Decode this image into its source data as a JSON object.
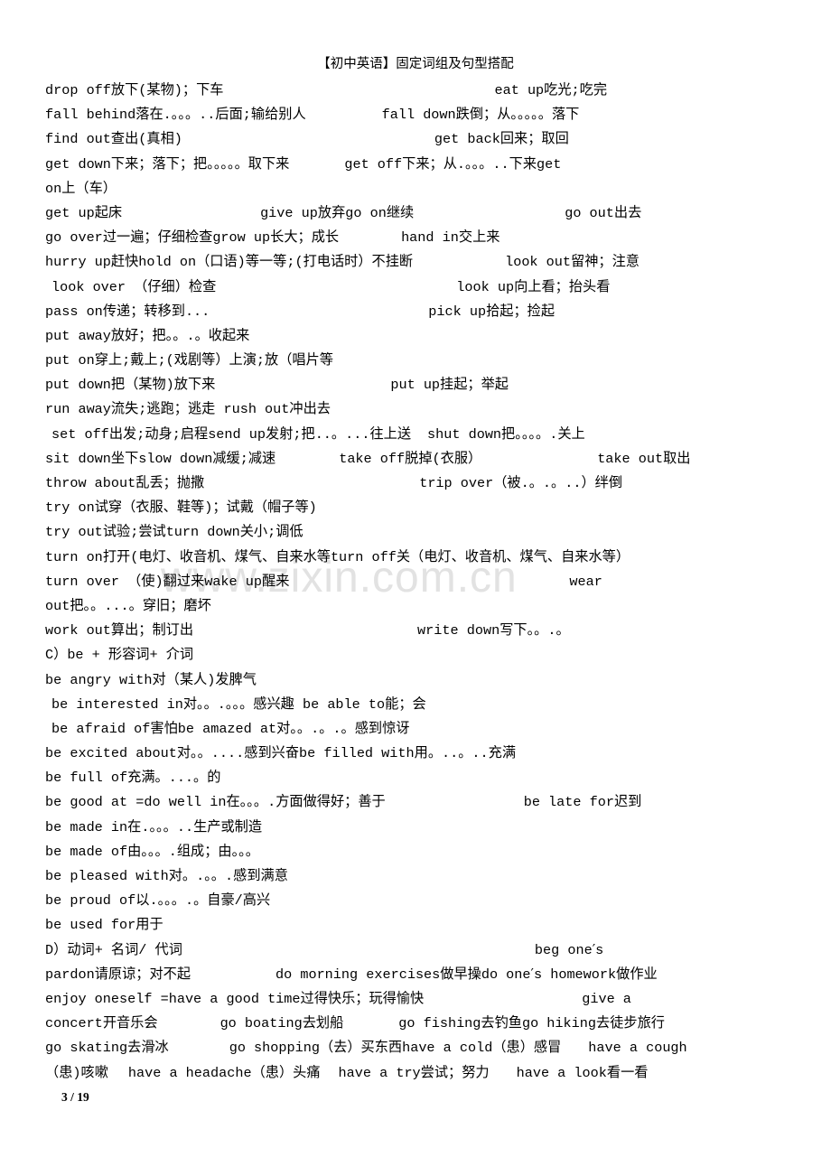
{
  "document": {
    "title": "【初中英语】固定词组及句型搭配",
    "page_number": "3 / 19",
    "watermark": "www.zixin.com.cn"
  },
  "lines": [
    {
      "id": "l1",
      "indent": 0,
      "left": "drop off放下(某物)；下车",
      "gap": 300,
      "right": "eat up吃光;吃完"
    },
    {
      "id": "l2",
      "indent": 0,
      "left": "fall behind落在.。。。..后面;输给别人",
      "gap": 84,
      "right": "fall down跌倒；从。。。。。落下"
    },
    {
      "id": "l3",
      "indent": 0,
      "left": "find out查出(真相)",
      "gap": 279,
      "right": "get back回来；取回"
    },
    {
      "id": "l4",
      "indent": 0,
      "left": "get down下来；落下；把。。。。。取下来",
      "gap": 61,
      "right": "get off下来；从.。。。..下来get"
    },
    {
      "id": "l5",
      "indent": 0,
      "left": "on上（车）",
      "gap": 0,
      "right": ""
    },
    {
      "id": "l6",
      "indent": 0,
      "left": "get up起床",
      "gap": 153,
      "right": "give up放弃go on继续",
      "gap2": 167,
      "right2": "go out出去"
    },
    {
      "id": "l7",
      "indent": 0,
      "left": "go over过一遍；仔细检查grow up长大；成长",
      "gap": 69,
      "right": "hand in交上来"
    },
    {
      "id": "l8",
      "indent": 0,
      "left": "hurry up赶快hold on（口语)等一等;(打电话时）不挂断",
      "gap": 102,
      "right": "look out留神；注意"
    },
    {
      "id": "l9",
      "indent": 7,
      "left": "look over （仔细）检查",
      "gap": 266,
      "right": "look up向上看；抬头看"
    },
    {
      "id": "l10",
      "indent": 0,
      "left": "pass on传递；转移到...",
      "gap": 242,
      "right": "pick up拾起；捡起"
    },
    {
      "id": "l11",
      "indent": 0,
      "left": "put away放好；把。。.。收起来",
      "gap": 0,
      "right": ""
    },
    {
      "id": "l12",
      "indent": 0,
      "left": "put on穿上;戴上;(戏剧等）上演;放（唱片等",
      "gap": 0,
      "right": ""
    },
    {
      "id": "l13",
      "indent": 0,
      "left": "put down把（某物)放下来",
      "gap": 194,
      "right": "put up挂起；举起"
    },
    {
      "id": "l14",
      "indent": 0,
      "left": "run away流失;逃跑；逃走  rush out冲出去",
      "gap": 0,
      "right": ""
    },
    {
      "id": "l15",
      "indent": 7,
      "left": "set off出发;动身;启程send up发射;把..。...往上送",
      "gap": 18,
      "right": "shut down把。。。。.关上"
    },
    {
      "id": "l16",
      "indent": 0,
      "left": "sit down坐下slow down减缓;减速",
      "gap": 70,
      "right": "take off脱掉(衣服）",
      "gap2": 128,
      "right2": "take out取出"
    },
    {
      "id": "l17",
      "indent": 0,
      "left": "throw about乱丢；抛撒",
      "gap": 238,
      "right": "trip over（被.。.。..）绊倒"
    },
    {
      "id": "l18",
      "indent": 0,
      "left": "try on试穿（衣服、鞋等)；试戴（帽子等)",
      "gap": 0,
      "right": ""
    },
    {
      "id": "l19",
      "indent": 0,
      "left": "try out试验;尝试turn down关小;调低",
      "gap": 0,
      "right": ""
    },
    {
      "id": "l20",
      "indent": 0,
      "left": "turn on打开(电灯、收音机、煤气、自来水等turn off关（电灯、收音机、煤气、自来水等）",
      "gap": 0,
      "right": ""
    },
    {
      "id": "l21",
      "indent": 0,
      "left": "turn over （使)翻过来wake up醒来",
      "gap": 310,
      "right": "wear"
    },
    {
      "id": "l22",
      "indent": 0,
      "left": "out把。。...。穿旧；磨坏",
      "gap": 0,
      "right": ""
    },
    {
      "id": "l23",
      "indent": 0,
      "left": "work out算出；制订出",
      "gap": 248,
      "right": "write down写下。。.。"
    },
    {
      "id": "l24",
      "indent": 0,
      "left": "C）be + 形容词+ 介词",
      "gap": 0,
      "right": ""
    },
    {
      "id": "l25",
      "indent": 0,
      "left": "be angry with对（某人)发脾气",
      "gap": 0,
      "right": ""
    },
    {
      "id": "l26",
      "indent": 7,
      "left": "be interested in对。。.。。。感兴趣  be able to能；会",
      "gap": 0,
      "right": ""
    },
    {
      "id": "l27",
      "indent": 7,
      "left": "be afraid of害怕be amazed at对。。.。.。感到惊讶",
      "gap": 0,
      "right": ""
    },
    {
      "id": "l28",
      "indent": 0,
      "left": "be excited about对。。....感到兴奋be filled with用。..。..充满",
      "gap": 0,
      "right": ""
    },
    {
      "id": "l29",
      "indent": 0,
      "left": "be full of充满。...。的",
      "gap": 0,
      "right": ""
    },
    {
      "id": "l30",
      "indent": 0,
      "left": "be good at =do well in在。。。.方面做得好；善于",
      "gap": 153,
      "right": "be late for迟到"
    },
    {
      "id": "l31",
      "indent": 0,
      "left": "be made in在.。。。..生产或制造",
      "gap": 0,
      "right": ""
    },
    {
      "id": "l32",
      "indent": 0,
      "left": "be made of由。。。.组成；由。。。",
      "gap": 0,
      "right": ""
    },
    {
      "id": "l33",
      "indent": 0,
      "left": "be pleased with对。.。。.感到满意",
      "gap": 0,
      "right": ""
    },
    {
      "id": "l34",
      "indent": 0,
      "left": "be proud of以.。。。.。自豪/高兴",
      "gap": 0,
      "right": ""
    },
    {
      "id": "l35",
      "indent": 0,
      "left": "be used for用于",
      "gap": 0,
      "right": ""
    },
    {
      "id": "l36",
      "indent": 0,
      "left": "D）动词+ 名词/ 代词",
      "gap": 390,
      "right": "beg one′s"
    },
    {
      "id": "l37",
      "indent": 0,
      "left": "pardon请原谅；对不起",
      "gap": 94,
      "right": "do morning exercises做早操do one′s homework做作业"
    },
    {
      "id": "l38",
      "indent": 0,
      "left": "enjoy oneself =have a good time过得快乐；玩得愉快",
      "gap": 175,
      "right": "give a"
    },
    {
      "id": "l39",
      "indent": 0,
      "left": "concert开音乐会",
      "gap": 69,
      "right": "go boating去划船",
      "gap2": 61,
      "right2": "go fishing去钓鱼go hiking去徒步旅行"
    },
    {
      "id": "l40",
      "indent": 0,
      "left": "go skating去滑冰",
      "gap": 67,
      "right": "go shopping（去）买东西have a cold（患）感冒",
      "gap2": 30,
      "right2": "have a cough"
    },
    {
      "id": "l41",
      "indent": 0,
      "left": "（患)咳嗽",
      "gap": 22,
      "right": "have a headache（患）头痛",
      "gap2": 20,
      "right2": "have a try尝试；努力",
      "gap3": 30,
      "right3": "have a look看一看"
    }
  ]
}
